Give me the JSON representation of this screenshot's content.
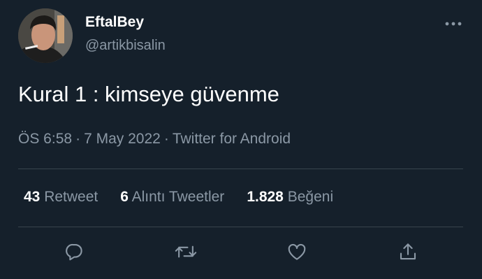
{
  "user": {
    "display_name": "EftalBey",
    "handle": "@artikbisalin"
  },
  "tweet": {
    "text": "Kural 1 : kimseye güvenme",
    "time": "ÖS 6:58",
    "date": "7 May 2022",
    "source": "Twitter for Android",
    "separator": "·"
  },
  "stats": [
    {
      "count": "43",
      "label": "Retweet"
    },
    {
      "count": "6",
      "label": "Alıntı Tweetler"
    },
    {
      "count": "1.828",
      "label": "Beğeni"
    }
  ],
  "icons": {
    "more": "more-horizontal-icon",
    "reply": "reply-icon",
    "retweet": "retweet-icon",
    "like": "heart-icon",
    "share": "share-icon"
  },
  "colors": {
    "background": "#15202b",
    "text_primary": "#ffffff",
    "text_secondary": "#8b98a5",
    "divider": "#38444d"
  }
}
